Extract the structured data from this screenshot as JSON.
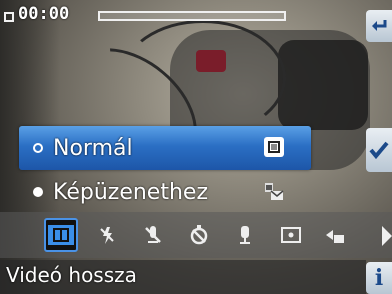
{
  "status": {
    "timer": "00:00",
    "progress_fraction": 0.0
  },
  "menu": {
    "items": [
      {
        "label": "Normál",
        "radio": "hollow",
        "icon": "film-icon",
        "selected": true
      },
      {
        "label": "Képüzenethez",
        "radio": "filled",
        "icon": "message-video-icon",
        "selected": false
      }
    ]
  },
  "toolbar": {
    "tools": [
      {
        "name": "video-mode-icon",
        "active": true
      },
      {
        "name": "flash-icon",
        "active": false
      },
      {
        "name": "mic-off-icon",
        "active": false
      },
      {
        "name": "self-timer-off-icon",
        "active": false
      },
      {
        "name": "microphone-icon",
        "active": false
      },
      {
        "name": "spot-metering-icon",
        "active": false
      },
      {
        "name": "quality-icon",
        "active": false
      }
    ]
  },
  "caption": {
    "text": "Videó hossza"
  },
  "side_buttons": {
    "back": "back-arrow-icon",
    "ok": "checkmark-icon",
    "info": "info-icon"
  },
  "colors": {
    "accent": "#2b6fc4",
    "active_border": "#4a92e6"
  }
}
